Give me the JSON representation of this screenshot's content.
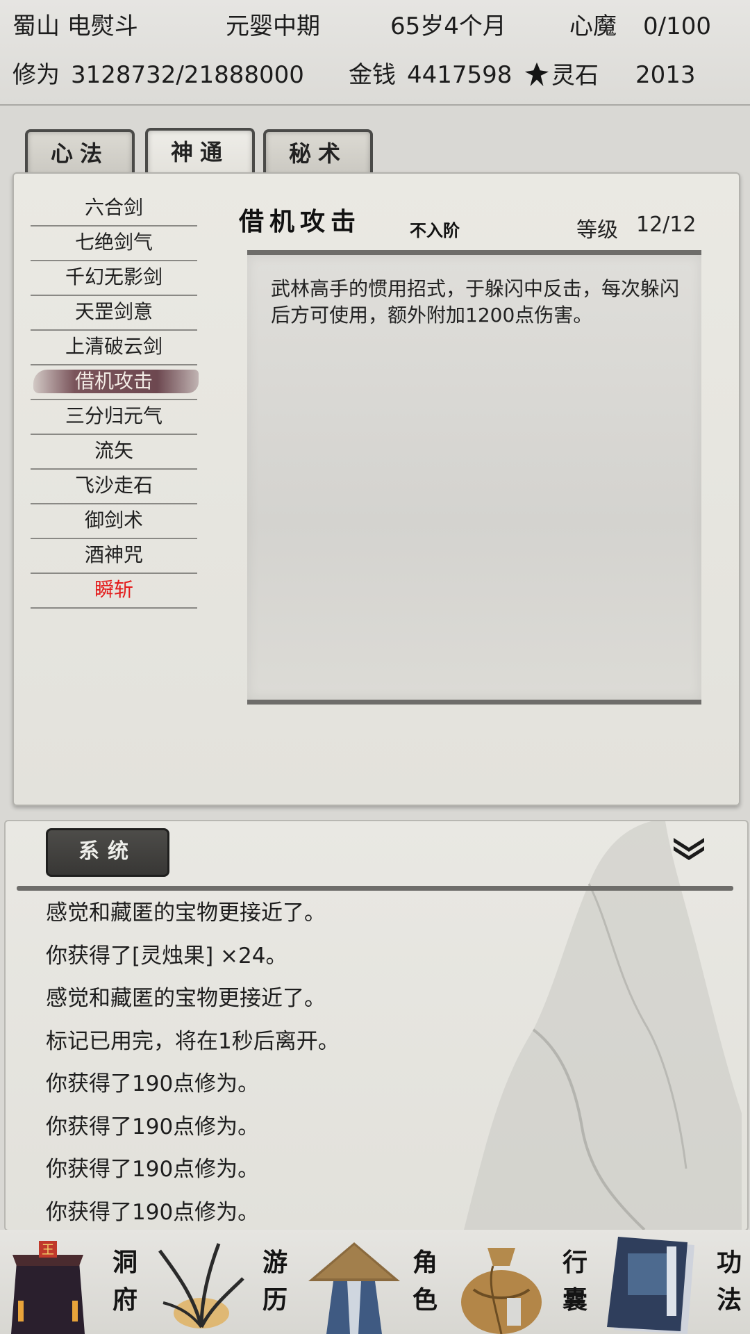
{
  "status": {
    "location": "蜀山 电熨斗",
    "realm": "元婴中期",
    "age": "65岁4个月",
    "demon_label": "心魔",
    "demon_value": "0/100",
    "cultivation_label": "修为",
    "cultivation_value": "3128732/21888000",
    "money_label": "金钱",
    "money_value": "4417598",
    "spirit_stone_label": "灵石",
    "spirit_stone_value": "2013"
  },
  "tabs": [
    {
      "label": "心法",
      "active": false
    },
    {
      "label": "神通",
      "active": true
    },
    {
      "label": "秘术",
      "active": false
    }
  ],
  "skills": [
    {
      "label": "六合剑"
    },
    {
      "label": "七绝剑气"
    },
    {
      "label": "千幻无影剑"
    },
    {
      "label": "天罡剑意"
    },
    {
      "label": "上清破云剑"
    },
    {
      "label": "借机攻击",
      "selected": true
    },
    {
      "label": "三分归元气"
    },
    {
      "label": "流矢"
    },
    {
      "label": "飞沙走石"
    },
    {
      "label": "御剑术"
    },
    {
      "label": "酒神咒"
    },
    {
      "label": "瞬斩",
      "special": true,
      "color": "#e41c1c"
    }
  ],
  "detail": {
    "name": "借机攻击",
    "tier": "不入阶",
    "level_label": "等级",
    "level_value": "12/12",
    "description": "武林高手的惯用招式，于躲闪中反击，每次躲闪后方可使用，额外附加1200点伤害。"
  },
  "log": {
    "tab_label": "系统",
    "collapse_icon": "double-chevron-down-icon",
    "lines": [
      "感觉和藏匿的宝物更接近了。",
      "你获得了[灵烛果] ×24。",
      "感觉和藏匿的宝物更接近了。",
      "标记已用完，将在1秒后离开。",
      "你获得了190点修为。",
      "你获得了190点修为。",
      "你获得了190点修为。",
      "你获得了190点修为。"
    ]
  },
  "nav": [
    {
      "label_top": "洞",
      "label_bottom": "府",
      "icon": "cave-dwelling-icon"
    },
    {
      "label_top": "游",
      "label_bottom": "历",
      "icon": "travel-grass-icon"
    },
    {
      "label_top": "角",
      "label_bottom": "色",
      "icon": "character-straw-hat-icon"
    },
    {
      "label_top": "行",
      "label_bottom": "囊",
      "icon": "bag-icon"
    },
    {
      "label_top": "功",
      "label_bottom": "法",
      "icon": "skill-book-icon"
    }
  ],
  "colors": {
    "background": "#d9d8d4",
    "panel": "#e6e5df",
    "selected_highlight": "#6d4850",
    "special_skill": "#e41c1c",
    "dark_tab": "#3f3e3b"
  }
}
